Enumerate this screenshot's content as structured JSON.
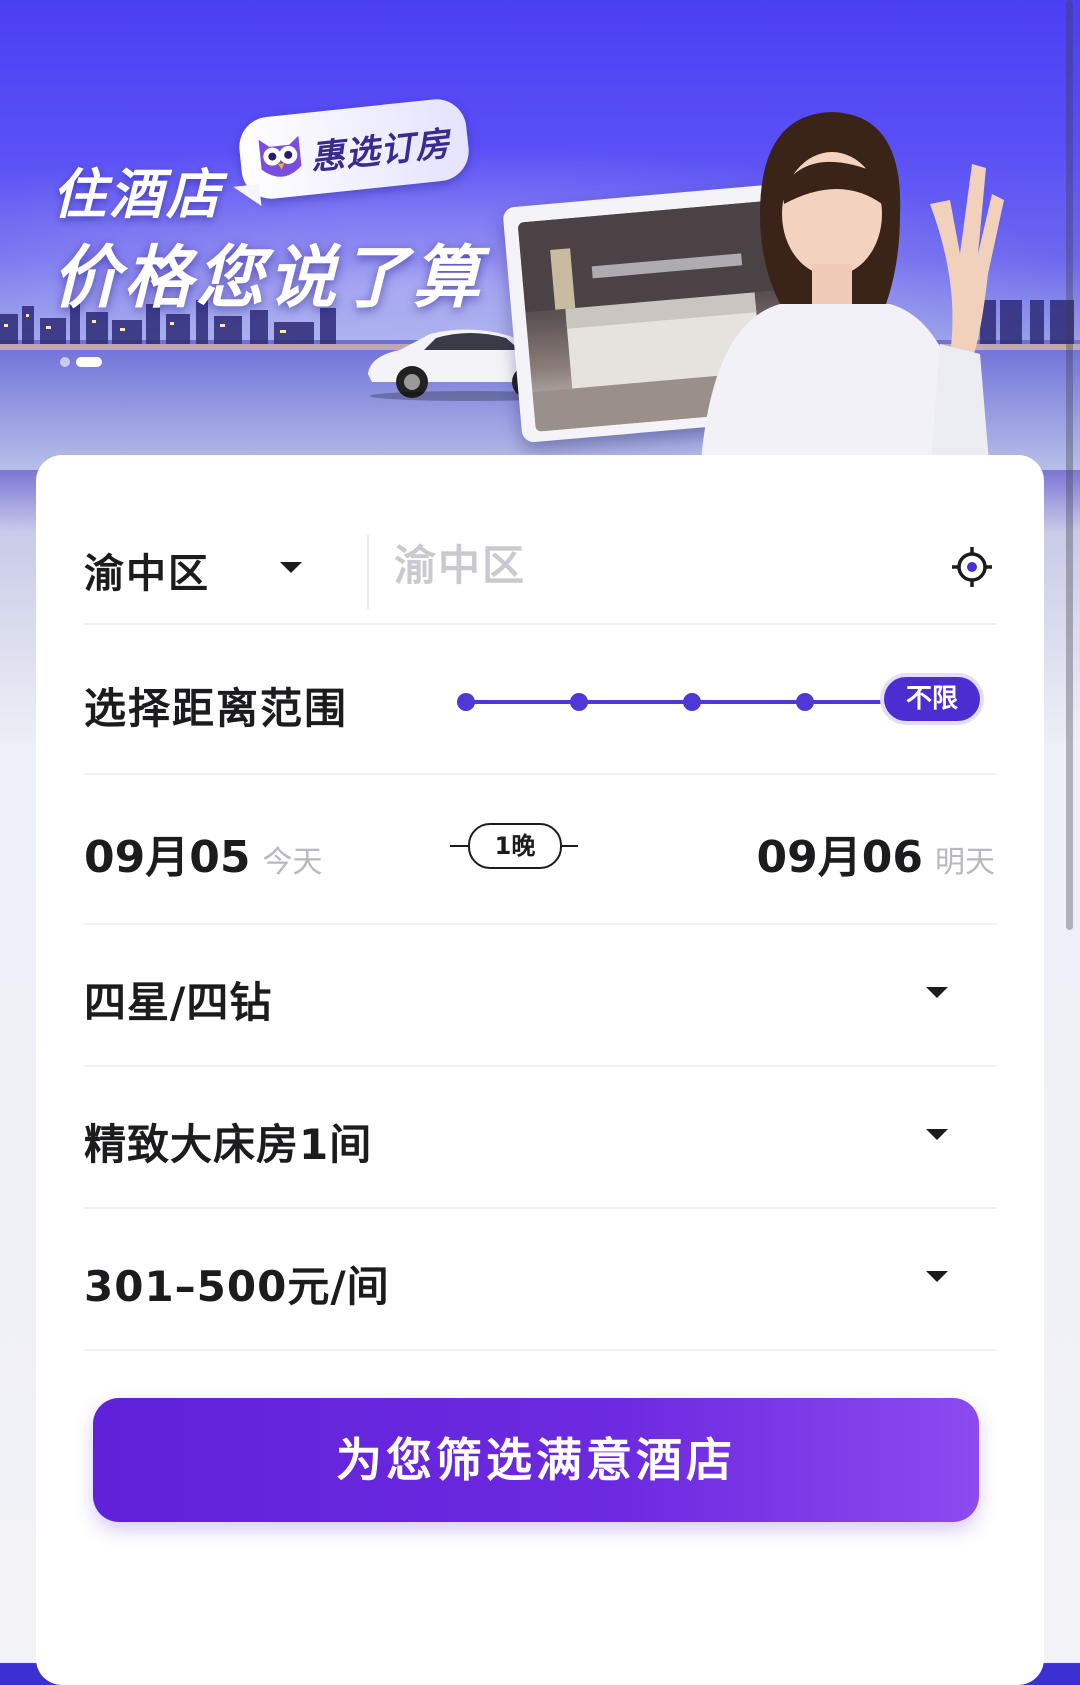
{
  "hero": {
    "brand": "惠选订房",
    "title_line1": "住酒店",
    "title_line2": "价格您说了算"
  },
  "search": {
    "city": "渝中区",
    "keyword_placeholder": "渝中区",
    "icons": {
      "city_dropdown": "chevron-down-icon",
      "locate": "locate-icon"
    }
  },
  "distance": {
    "label": "选择距离范围",
    "selected": "不限",
    "stops": 5,
    "selected_index": 4
  },
  "dates": {
    "checkin": "09月05",
    "checkin_note": "今天",
    "nights": "1晚",
    "checkout": "09月06",
    "checkout_note": "明天"
  },
  "filters": {
    "star": "四星/四钻",
    "room": "精致大床房1间",
    "price": "301–500元/间"
  },
  "cta_label": "为您筛选满意酒店",
  "colors": {
    "accent": "#4b2ed2",
    "cta": "#6d2ae0",
    "text": "#1c1c1e",
    "muted": "#b8b8be"
  }
}
